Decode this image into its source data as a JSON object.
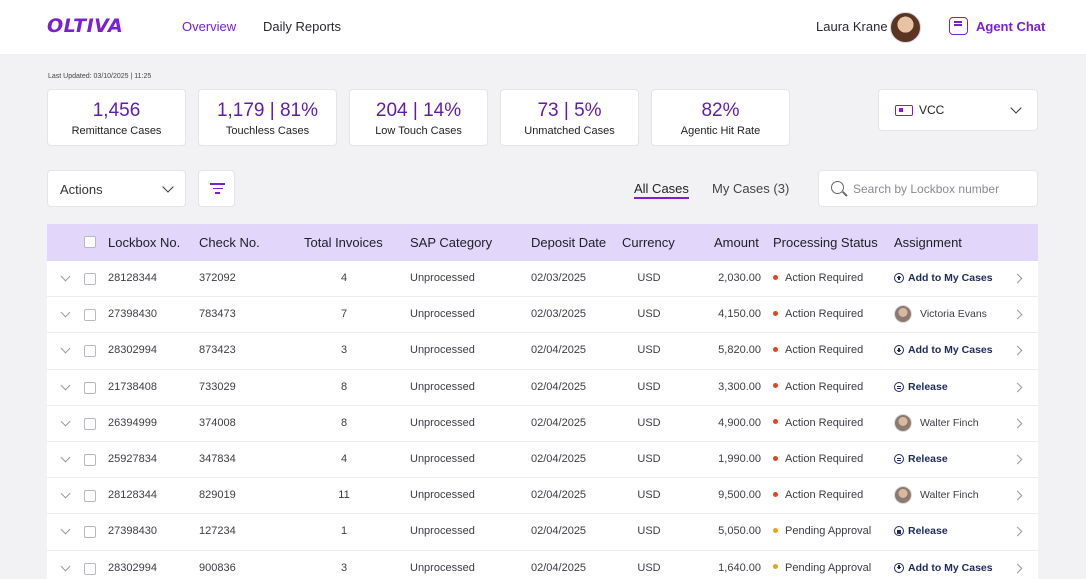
{
  "app": {
    "logo": "OLTIVA"
  },
  "nav": {
    "items": [
      {
        "label": "Overview",
        "active": true
      },
      {
        "label": "Daily Reports",
        "active": false
      }
    ]
  },
  "user": {
    "name": "Laura Krane",
    "agent_chat": "Agent Chat"
  },
  "last_updated": "Last Updated: 03/10/2025 | 11:25",
  "kpis": [
    {
      "value": "1,456",
      "label": "Remittance Cases"
    },
    {
      "value": "1,179  |  81%",
      "label": "Touchless Cases"
    },
    {
      "value": "204  |  14%",
      "label": "Low Touch Cases"
    },
    {
      "value": "73  |  5%",
      "label": "Unmatched Cases"
    },
    {
      "value": "82%",
      "label": "Agentic Hit Rate"
    }
  ],
  "vcc": {
    "label": "VCC"
  },
  "toolbar": {
    "actions_label": "Actions",
    "tabs": [
      {
        "label": "All Cases",
        "active": true
      },
      {
        "label": "My Cases (3)",
        "active": false
      }
    ],
    "search_placeholder": "Search by Lockbox number"
  },
  "table": {
    "columns": [
      "Lockbox No.",
      "Check No.",
      "Total Invoices",
      "SAP Category",
      "Deposit Date",
      "Currency",
      "Amount",
      "Processing Status",
      "Assignment"
    ],
    "status_colors": {
      "Action Required": "#e8421f",
      "Pending Approval": "#e8a317"
    },
    "rows": [
      {
        "lockbox": "28128344",
        "check": "372092",
        "invoices": "4",
        "sap": "Unprocessed",
        "date": "02/03/2025",
        "currency": "USD",
        "amount": "2,030.00",
        "status": "Action Required",
        "assignment": "Add to My Cases",
        "assignment_type": "add"
      },
      {
        "lockbox": "27398430",
        "check": "783473",
        "invoices": "7",
        "sap": "Unprocessed",
        "date": "02/03/2025",
        "currency": "USD",
        "amount": "4,150.00",
        "status": "Action Required",
        "assignment": "Victoria Evans",
        "assignment_type": "person"
      },
      {
        "lockbox": "28302994",
        "check": "873423",
        "invoices": "3",
        "sap": "Unprocessed",
        "date": "02/04/2025",
        "currency": "USD",
        "amount": "5,820.00",
        "status": "Action Required",
        "assignment": "Add to My Cases",
        "assignment_type": "add"
      },
      {
        "lockbox": "21738408",
        "check": "733029",
        "invoices": "8",
        "sap": "Unprocessed",
        "date": "02/04/2025",
        "currency": "USD",
        "amount": "3,300.00",
        "status": "Action Required",
        "assignment": "Release",
        "assignment_type": "release"
      },
      {
        "lockbox": "26394999",
        "check": "374008",
        "invoices": "8",
        "sap": "Unprocessed",
        "date": "02/04/2025",
        "currency": "USD",
        "amount": "4,900.00",
        "status": "Action Required",
        "assignment": "Walter Finch",
        "assignment_type": "person"
      },
      {
        "lockbox": "25927834",
        "check": "347834",
        "invoices": "4",
        "sap": "Unprocessed",
        "date": "02/04/2025",
        "currency": "USD",
        "amount": "1,990.00",
        "status": "Action Required",
        "assignment": "Release",
        "assignment_type": "release"
      },
      {
        "lockbox": "28128344",
        "check": "829019",
        "invoices": "11",
        "sap": "Unprocessed",
        "date": "02/04/2025",
        "currency": "USD",
        "amount": "9,500.00",
        "status": "Action Required",
        "assignment": "Walter Finch",
        "assignment_type": "person"
      },
      {
        "lockbox": "27398430",
        "check": "127234",
        "invoices": "1",
        "sap": "Unprocessed",
        "date": "02/04/2025",
        "currency": "USD",
        "amount": "5,050.00",
        "status": "Pending Approval",
        "assignment": "Release",
        "assignment_type": "release"
      },
      {
        "lockbox": "28302994",
        "check": "900836",
        "invoices": "3",
        "sap": "Unprocessed",
        "date": "02/04/2025",
        "currency": "USD",
        "amount": "1,640.00",
        "status": "Pending Approval",
        "assignment": "Add to My Cases",
        "assignment_type": "add"
      }
    ]
  }
}
